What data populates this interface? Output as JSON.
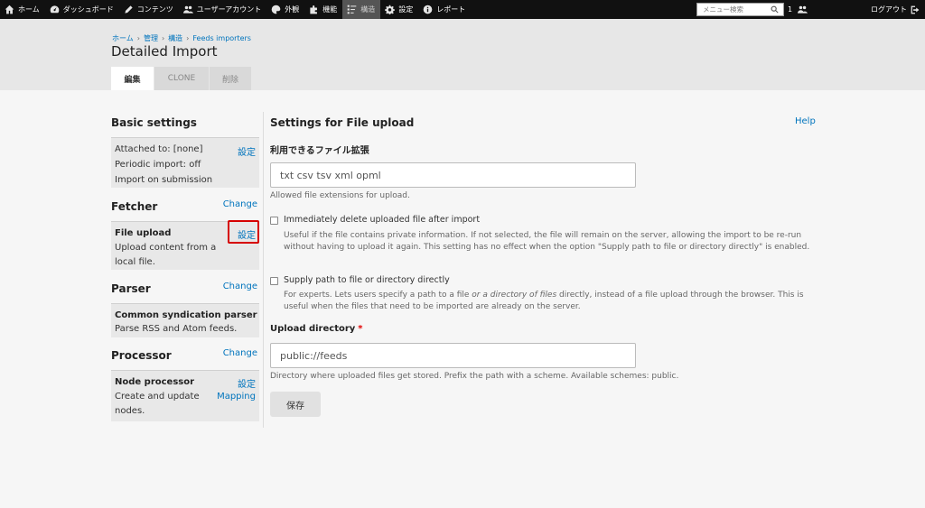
{
  "toolbar": {
    "items": [
      {
        "label": "ホーム",
        "icon": "home-icon"
      },
      {
        "label": "ダッシュボード",
        "icon": "dashboard-icon"
      },
      {
        "label": "コンテンツ",
        "icon": "pencil-icon"
      },
      {
        "label": "ユーザーアカウント",
        "icon": "users-icon"
      },
      {
        "label": "外観",
        "icon": "palette-icon"
      },
      {
        "label": "機能",
        "icon": "puzzle-icon"
      },
      {
        "label": "構造",
        "icon": "structure-icon"
      },
      {
        "label": "設定",
        "icon": "gear-icon"
      },
      {
        "label": "レポート",
        "icon": "info-icon"
      }
    ],
    "search_placeholder": "メニュー検索",
    "user_count": "1",
    "logout_label": "ログアウト"
  },
  "header": {
    "breadcrumb": [
      "ホーム",
      "管理",
      "構造",
      "Feeds importers"
    ],
    "title": "Detailed Import",
    "tabs": [
      "編集",
      "CLONE",
      "削除"
    ]
  },
  "left": {
    "basic_title": "Basic settings",
    "basic_link": "設定",
    "basic_lines": [
      "Attached to: [none]",
      "Periodic import: off",
      "Import on submission"
    ],
    "fetcher_title": "Fetcher",
    "fetcher_change": "Change",
    "fetcher_name": "File upload",
    "fetcher_settings": "設定",
    "fetcher_desc": [
      "Upload content from a",
      "local file."
    ],
    "parser_title": "Parser",
    "parser_change": "Change",
    "parser_name": "Common syndication parser",
    "parser_desc": "Parse RSS and Atom feeds.",
    "processor_title": "Processor",
    "processor_change": "Change",
    "processor_name": "Node processor",
    "processor_settings": "設定",
    "processor_mapping": "Mapping",
    "processor_desc": [
      "Create and update",
      "nodes."
    ]
  },
  "right": {
    "title": "Settings for File upload",
    "help": "Help",
    "ext_label": "利用できるファイル拡張",
    "ext_value": "txt csv tsv xml opml",
    "ext_desc": "Allowed file extensions for upload.",
    "cb1_label": "Immediately delete uploaded file after import",
    "cb1_desc": "Useful if the file contains private information. If not selected, the file will remain on the server, allowing the import to be re-run without having to upload it again. This setting has no effect when the option \"Supply path to file or directory directly\" is enabled.",
    "cb2_label": "Supply path to file or directory directly",
    "cb2_desc_a": "For experts. Lets users specify a path to a file ",
    "cb2_desc_em": "or a directory of files",
    "cb2_desc_b": " directly, instead of a file upload through the browser. This is useful when the files that need to be imported are already on the server.",
    "dir_label": "Upload directory",
    "dir_required": "*",
    "dir_value": "public://feeds",
    "dir_desc": "Directory where uploaded files get stored. Prefix the path with a scheme. Available schemes: public.",
    "save_label": "保存"
  },
  "colors": {
    "accent": "#0074bd",
    "highlight": "#d60000",
    "toolbar": "#111111"
  }
}
